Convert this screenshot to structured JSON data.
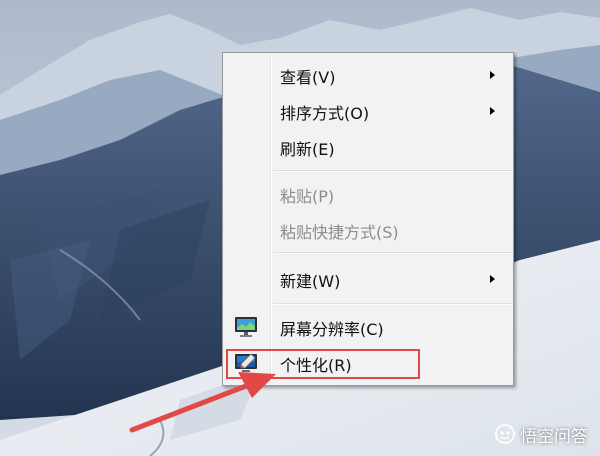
{
  "context_menu": {
    "items": [
      {
        "label": "查看(V)",
        "has_submenu": true,
        "enabled": true
      },
      {
        "label": "排序方式(O)",
        "has_submenu": true,
        "enabled": true
      },
      {
        "label": "刷新(E)",
        "has_submenu": false,
        "enabled": true
      },
      {
        "label": "粘贴(P)",
        "has_submenu": false,
        "enabled": false
      },
      {
        "label": "粘贴快捷方式(S)",
        "has_submenu": false,
        "enabled": false
      },
      {
        "label": "新建(W)",
        "has_submenu": true,
        "enabled": true
      },
      {
        "label": "屏幕分辨率(C)",
        "has_submenu": false,
        "enabled": true,
        "icon": "monitor-icon"
      },
      {
        "label": "个性化(R)",
        "has_submenu": false,
        "enabled": true,
        "icon": "personalize-icon"
      }
    ]
  },
  "annotation": {
    "highlight_color": "#e34848",
    "highlighted_item": "个性化(R)"
  },
  "watermark": {
    "text": "悟空问答",
    "icon": "wukong-logo-icon"
  }
}
